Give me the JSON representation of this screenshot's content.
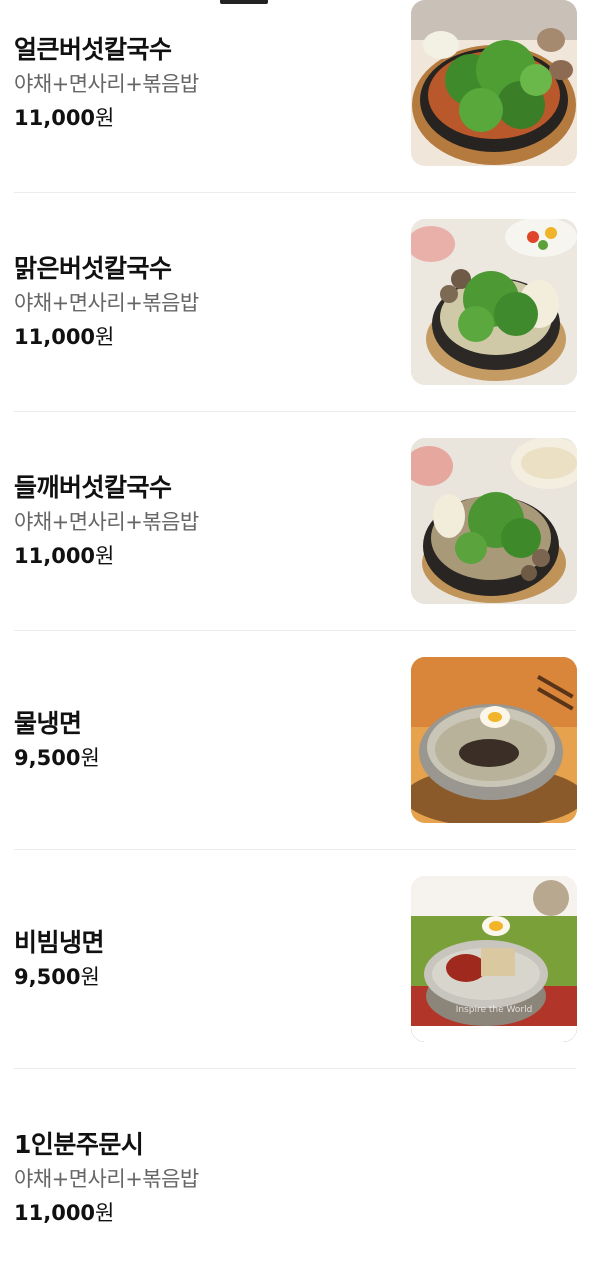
{
  "menu": {
    "items": [
      {
        "name": "얼큰버섯칼국수",
        "desc": "야채+면사리+볶음밥",
        "price": "11,000",
        "currency": "원",
        "image": "mushroom-kalguksu-spicy-photo"
      },
      {
        "name": "맑은버섯칼국수",
        "desc": "야채+면사리+볶음밥",
        "price": "11,000",
        "currency": "원",
        "image": "mushroom-kalguksu-clear-photo"
      },
      {
        "name": "들깨버섯칼국수",
        "desc": "야채+면사리+볶음밥",
        "price": "11,000",
        "currency": "원",
        "image": "mushroom-kalguksu-perilla-photo"
      },
      {
        "name": "물냉면",
        "desc": "",
        "price": "9,500",
        "currency": "원",
        "image": "mul-naengmyeon-photo"
      },
      {
        "name": "비빔냉면",
        "desc": "",
        "price": "9,500",
        "currency": "원",
        "image": "bibim-naengmyeon-photo",
        "watermark": "Inspire the World"
      },
      {
        "name": "1인분주문시",
        "desc": "야채+면사리+볶음밥",
        "price": "11,000",
        "currency": "원"
      }
    ]
  }
}
